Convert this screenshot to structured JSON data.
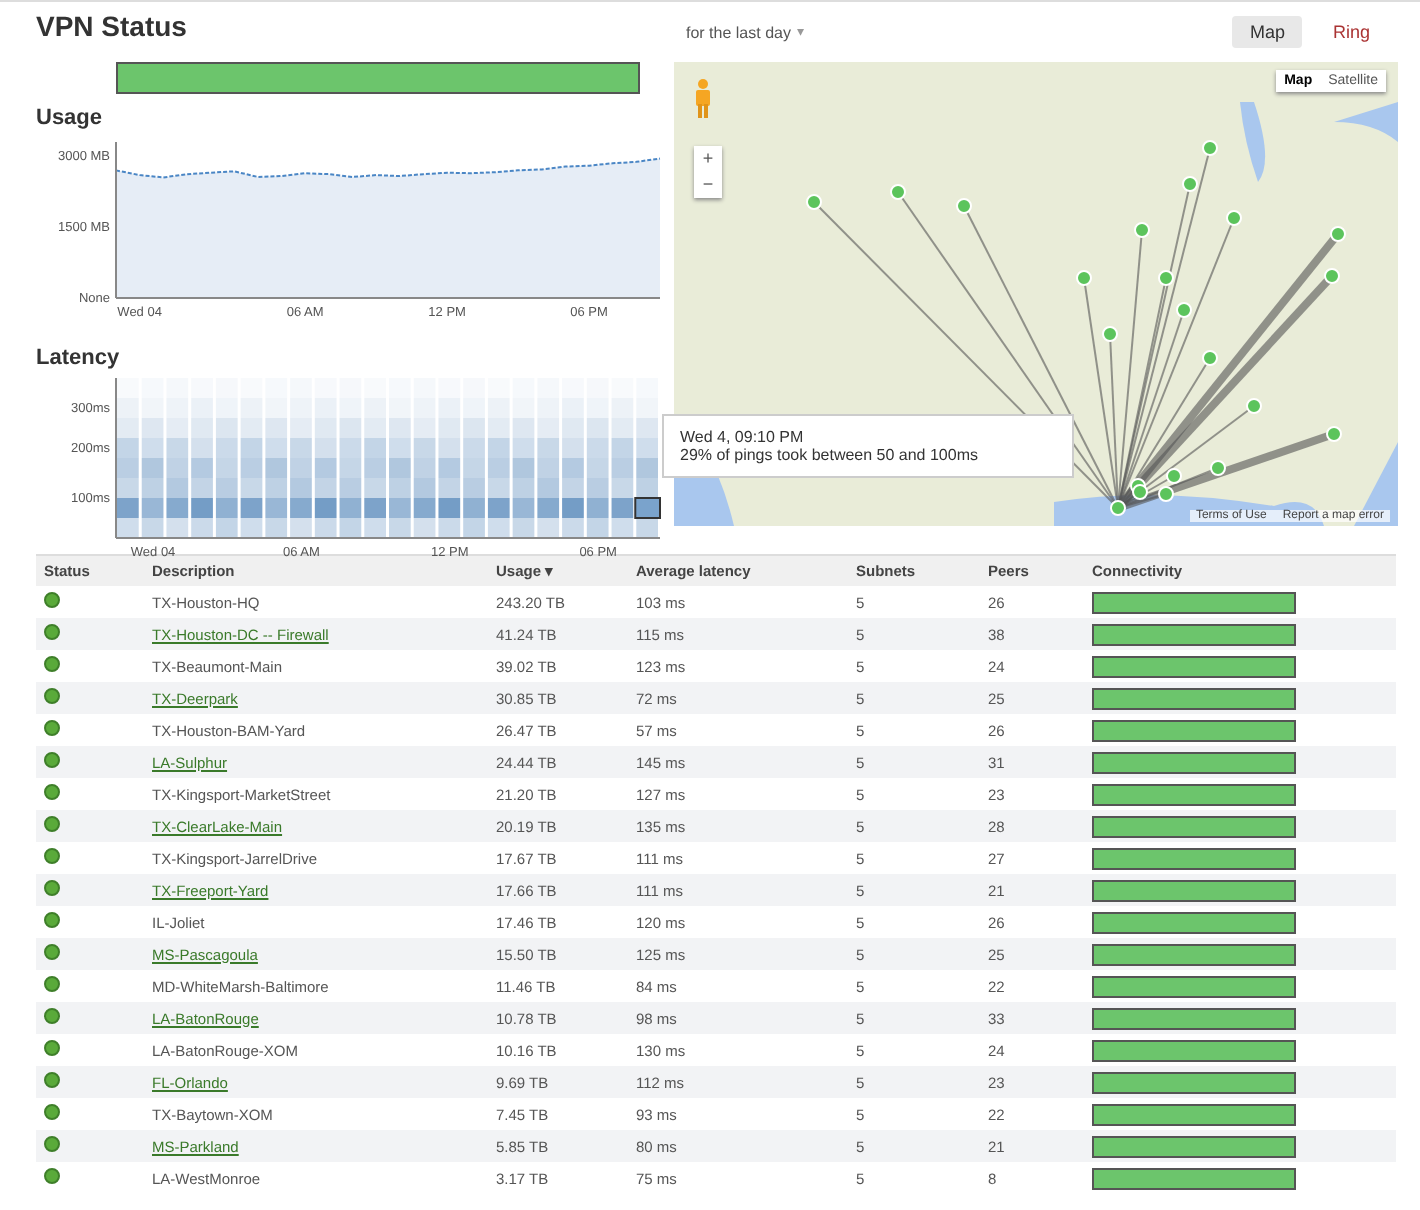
{
  "title": "VPN Status",
  "status_bar": {
    "level": 1
  },
  "usage": {
    "title": "Usage",
    "chart_data": {
      "type": "area",
      "categories": [
        null,
        "Wed 04",
        null,
        null,
        null,
        null,
        null,
        null,
        "06 AM",
        null,
        null,
        null,
        null,
        null,
        "12 PM",
        null,
        null,
        null,
        null,
        null,
        "06 PM",
        null,
        null,
        null
      ],
      "series": [
        {
          "color": "#4a86c5",
          "values": [
            2700,
            2600,
            2550,
            2620,
            2650,
            2680,
            2560,
            2580,
            2640,
            2620,
            2560,
            2600,
            2580,
            2620,
            2650,
            2640,
            2660,
            2700,
            2720,
            2780,
            2800,
            2850,
            2880,
            2950
          ]
        }
      ],
      "ylim": [
        0,
        3300
      ],
      "yticks": [
        {
          "value": 0,
          "label": "None"
        },
        {
          "value": 1500,
          "label": "1500 MB"
        },
        {
          "value": 3000,
          "label": "3000 MB"
        }
      ]
    }
  },
  "latency": {
    "title": "Latency",
    "yticks": [
      "300ms",
      "200ms",
      "100ms"
    ],
    "xticks": [
      "Wed 04",
      "06 AM",
      "12 PM",
      "06 PM"
    ]
  },
  "range": {
    "value": "for the last day",
    "caret": "▾"
  },
  "view_tabs": [
    {
      "label": "Map",
      "selected": true
    },
    {
      "label": "Ring",
      "selected": false
    }
  ],
  "map": {
    "types": [
      {
        "label": "Map",
        "selected": true
      },
      {
        "label": "Satellite",
        "selected": false
      }
    ],
    "zoom_in": "+",
    "zoom_out": "−",
    "attribution": [
      "Terms of Use",
      "Report a map error"
    ]
  },
  "tooltip": {
    "time": "Wed 4, 09:10 PM",
    "text": "29% of pings took between 50 and 100ms"
  },
  "table": {
    "columns": [
      "Status",
      "Description",
      "Usage ▾",
      "Average latency",
      "Subnets",
      "Peers",
      "Connectivity"
    ],
    "rows": [
      {
        "kind": "text",
        "description": "TX-Houston-HQ",
        "usage": "243.20 TB",
        "latency": "103 ms",
        "subnets": "5",
        "peers": "26",
        "level": 1
      },
      {
        "kind": "link",
        "description": "TX-Houston-DC -- Firewall",
        "usage": "41.24 TB",
        "latency": "115 ms",
        "subnets": "5",
        "peers": "38",
        "level": 1
      },
      {
        "kind": "text",
        "description": "TX-Beaumont-Main",
        "usage": "39.02 TB",
        "latency": "123 ms",
        "subnets": "5",
        "peers": "24",
        "level": 1
      },
      {
        "kind": "link",
        "description": "TX-Deerpark",
        "usage": "30.85 TB",
        "latency": "72 ms",
        "subnets": "5",
        "peers": "25",
        "level": 1
      },
      {
        "kind": "text",
        "description": "TX-Houston-BAM-Yard",
        "usage": "26.47 TB",
        "latency": "57 ms",
        "subnets": "5",
        "peers": "26",
        "level": 1
      },
      {
        "kind": "link",
        "description": "LA-Sulphur",
        "usage": "24.44 TB",
        "latency": "145 ms",
        "subnets": "5",
        "peers": "31",
        "level": 1
      },
      {
        "kind": "text",
        "description": "TX-Kingsport-MarketStreet",
        "usage": "21.20 TB",
        "latency": "127 ms",
        "subnets": "5",
        "peers": "23",
        "level": 1
      },
      {
        "kind": "link",
        "description": "TX-ClearLake-Main",
        "usage": "20.19 TB",
        "latency": "135 ms",
        "subnets": "5",
        "peers": "28",
        "level": 1
      },
      {
        "kind": "text",
        "description": "TX-Kingsport-JarrelDrive",
        "usage": "17.67 TB",
        "latency": "111 ms",
        "subnets": "5",
        "peers": "27",
        "level": 1
      },
      {
        "kind": "link",
        "description": "TX-Freeport-Yard",
        "usage": "17.66 TB",
        "latency": "111 ms",
        "subnets": "5",
        "peers": "21",
        "level": 1
      },
      {
        "kind": "text",
        "description": "IL-Joliet",
        "usage": "17.46 TB",
        "latency": "120 ms",
        "subnets": "5",
        "peers": "26",
        "level": 1
      },
      {
        "kind": "link",
        "description": "MS-Pascagoula",
        "usage": "15.50 TB",
        "latency": "125 ms",
        "subnets": "5",
        "peers": "25",
        "level": 1
      },
      {
        "kind": "text",
        "description": "MD-WhiteMarsh-Baltimore",
        "usage": "11.46 TB",
        "latency": "84 ms",
        "subnets": "5",
        "peers": "22",
        "level": 1
      },
      {
        "kind": "link",
        "description": "LA-BatonRouge",
        "usage": "10.78 TB",
        "latency": "98 ms",
        "subnets": "5",
        "peers": "33",
        "level": 1
      },
      {
        "kind": "text",
        "description": "LA-BatonRouge-XOM",
        "usage": "10.16 TB",
        "latency": "130 ms",
        "subnets": "5",
        "peers": "24",
        "level": 1
      },
      {
        "kind": "link",
        "description": "FL-Orlando",
        "usage": "9.69 TB",
        "latency": "112 ms",
        "subnets": "5",
        "peers": "23",
        "level": 1
      },
      {
        "kind": "text",
        "description": "TX-Baytown-XOM",
        "usage": "7.45 TB",
        "latency": "93 ms",
        "subnets": "5",
        "peers": "22",
        "level": 1
      },
      {
        "kind": "link",
        "description": "MS-Parkland",
        "usage": "5.85 TB",
        "latency": "80 ms",
        "subnets": "5",
        "peers": "21",
        "level": 1
      },
      {
        "kind": "text",
        "description": "LA-WestMonroe",
        "usage": "3.17 TB",
        "latency": "75 ms",
        "subnets": "5",
        "peers": "8",
        "level": 1
      }
    ]
  }
}
